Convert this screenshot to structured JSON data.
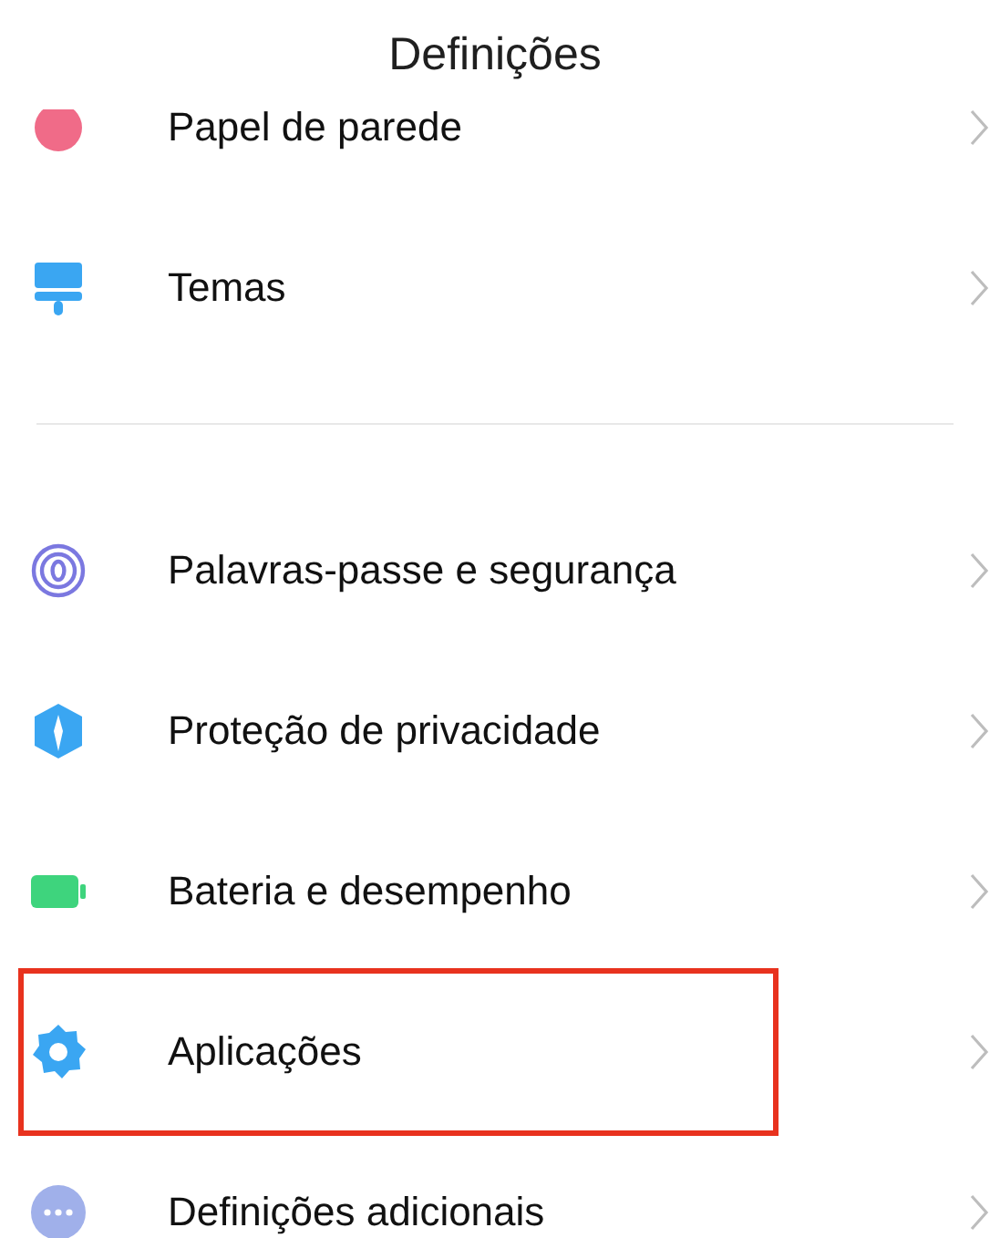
{
  "header": {
    "title": "Definições"
  },
  "groups": [
    {
      "items": [
        {
          "kind": "wallpaper",
          "label": "Papel de parede",
          "highlighted": false
        },
        {
          "kind": "themes",
          "label": "Temas",
          "highlighted": false
        }
      ]
    },
    {
      "items": [
        {
          "kind": "fingerprint",
          "label": "Palavras-passe e segurança",
          "highlighted": false
        },
        {
          "kind": "privacy",
          "label": "Proteção de privacidade",
          "highlighted": false
        },
        {
          "kind": "battery",
          "label": "Bateria e desempenho",
          "highlighted": false
        },
        {
          "kind": "apps",
          "label": "Aplicações",
          "highlighted": true
        },
        {
          "kind": "more",
          "label": "Definições adicionais",
          "highlighted": false
        }
      ]
    }
  ]
}
